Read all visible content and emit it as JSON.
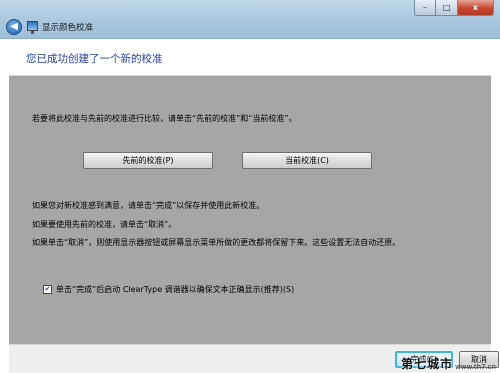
{
  "window": {
    "title": "显示颜色校准",
    "controls": {
      "minimize": "–",
      "maximize": "□",
      "close": "x"
    }
  },
  "header": {
    "title": "您已成功创建了一个新的校准"
  },
  "body": {
    "compare_text": "若要将此校准与先前的校准进行比较，请单击“先前的校准”和“当前校准”。",
    "previous_button": "先前的校准(P)",
    "current_button": "当前校准(C)",
    "satisfied_text": "如果您对新校准感到满意，请单击“完成”以保存并使用此新校准。",
    "use_previous_text": "如果要使用先前的校准，请单击“取消”。",
    "cancel_note_text": "如果单击“取消”，则使用显示器按钮或屏幕显示菜单所做的更改都将保留下来。这些设置无法自动还原。",
    "cleartype_checkbox": {
      "checked": true,
      "label": "单击“完成”后启动 ClearType 调谐器以确保文本正确显示(推荐)(S)"
    }
  },
  "footer": {
    "finish_button": "完成(F)",
    "cancel_button": "取消"
  },
  "watermark": {
    "main": "第七城市",
    "sub": "www.th7.cn"
  },
  "colors": {
    "header_text": "#1e3ea8",
    "gray_panel": "#a6a6a6",
    "focus_border": "#3fb4d8"
  }
}
